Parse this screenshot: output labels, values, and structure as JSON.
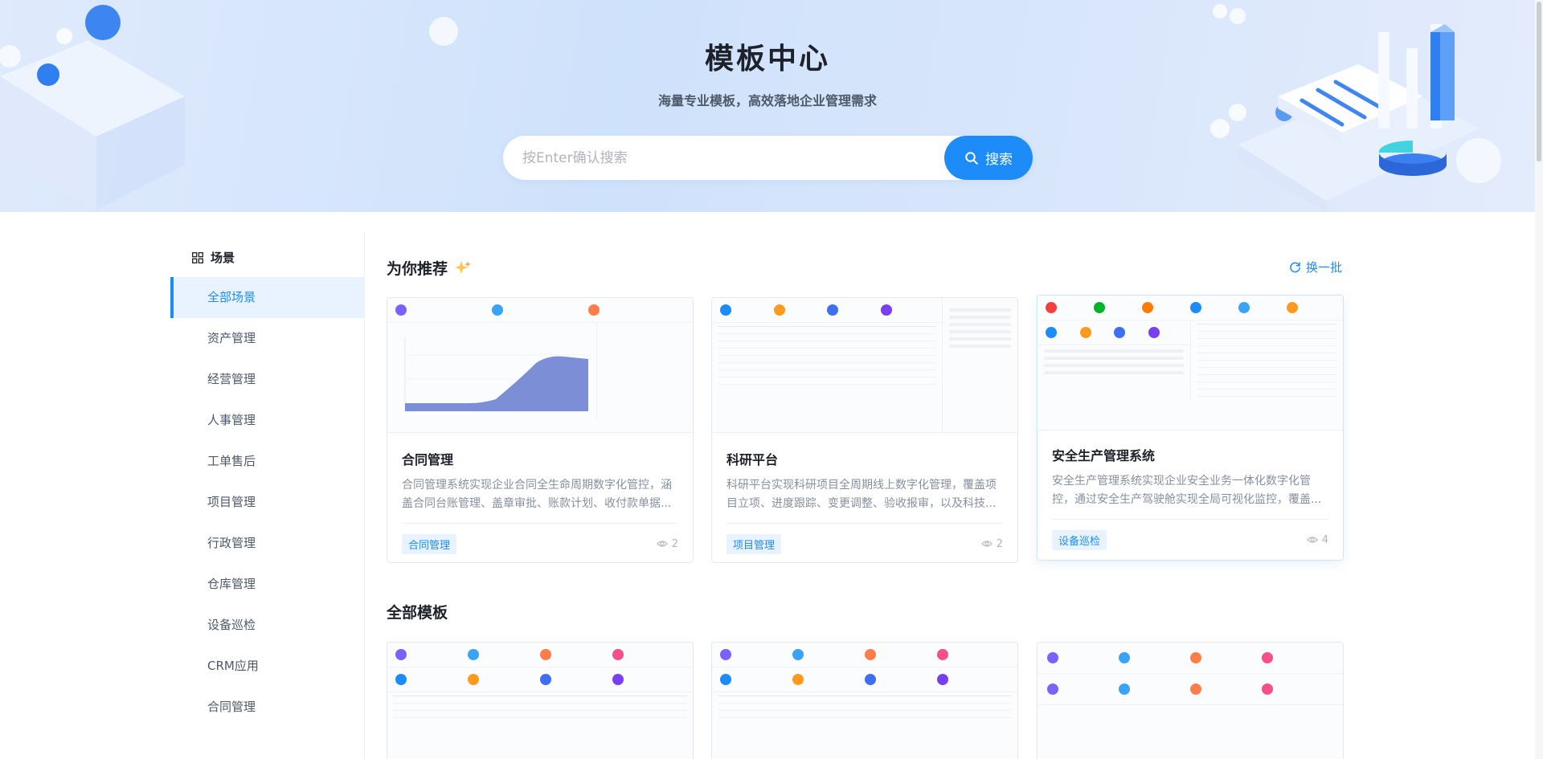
{
  "hero": {
    "title": "模板中心",
    "subtitle": "海量专业模板，高效落地企业管理需求",
    "search_placeholder": "按Enter确认搜索",
    "search_button": "搜索"
  },
  "sidebar": {
    "heading": "场景",
    "items": [
      {
        "label": "全部场景",
        "active": true
      },
      {
        "label": "资产管理"
      },
      {
        "label": "经营管理"
      },
      {
        "label": "人事管理"
      },
      {
        "label": "工单售后"
      },
      {
        "label": "项目管理"
      },
      {
        "label": "行政管理"
      },
      {
        "label": "仓库管理"
      },
      {
        "label": "设备巡检"
      },
      {
        "label": "CRM应用"
      },
      {
        "label": "合同管理"
      }
    ]
  },
  "recommend": {
    "title": "为你推荐",
    "refresh_label": "换一批",
    "cards": [
      {
        "title": "合同管理",
        "desc": "合同管理系统实现企业合同全生命周期数字化管控，涵盖合同台账管理、盖章审批、账款计划、收付款单据...",
        "tag": "合同管理",
        "views": "2"
      },
      {
        "title": "科研平台",
        "desc": "科研平台实现科研项目全周期线上数字化管理，覆盖项目立项、进度跟踪、变更调整、验收报审，以及科技...",
        "tag": "项目管理",
        "views": "2"
      },
      {
        "title": "安全生产管理系统",
        "desc": "安全生产管理系统实现企业安全业务一体化数字化管控，通过安全生产驾驶舱实现全局可视化监控，覆盖...",
        "tag": "设备巡检",
        "views": "4"
      }
    ]
  },
  "all_templates": {
    "title": "全部模板"
  },
  "colors": {
    "accent": "#1d8cf8",
    "accent_bg": "#e8f3ff"
  }
}
